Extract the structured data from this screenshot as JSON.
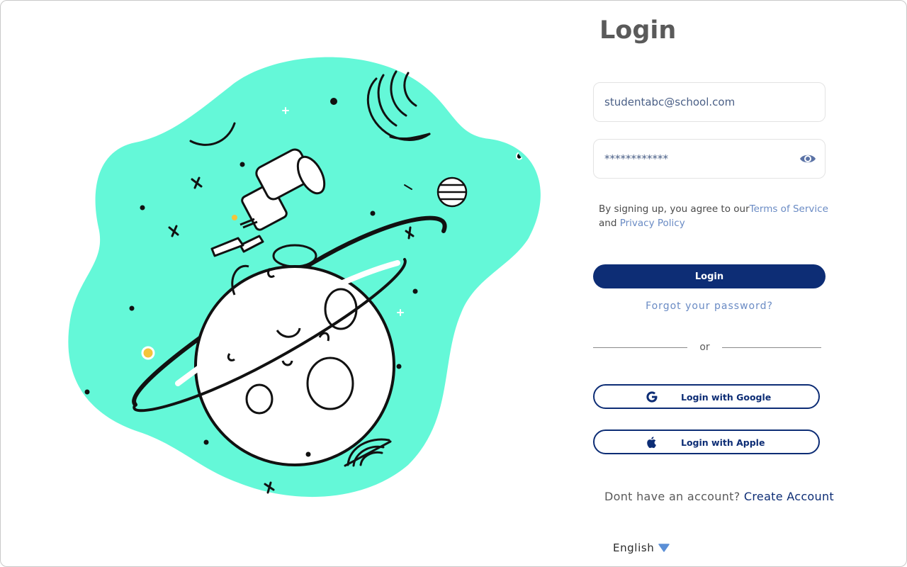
{
  "page": {
    "title": "Login"
  },
  "form": {
    "email_value": "studentabc@school.com",
    "password_value": "************",
    "terms_prefix": "By signing up, you agree to our",
    "terms_link": "Terms of Service",
    "terms_and": "and",
    "privacy_link": "Privacy Policy",
    "login_label": "Login",
    "forgot_label": "Forgot your password?",
    "divider_label": "or",
    "google_label": "Login with Google",
    "apple_label": "Login with Apple",
    "signup_prompt": "Dont have an account?",
    "signup_link": "Create Account"
  },
  "footer": {
    "language": "English"
  },
  "icons": {
    "password_toggle": "eye-icon",
    "google": "google-icon",
    "apple": "apple-icon",
    "language_dropdown": "chevron-down-icon"
  },
  "colors": {
    "primary": "#0d2d75",
    "link": "#6a8bc4",
    "illustration_bg": "#64f8d8"
  }
}
